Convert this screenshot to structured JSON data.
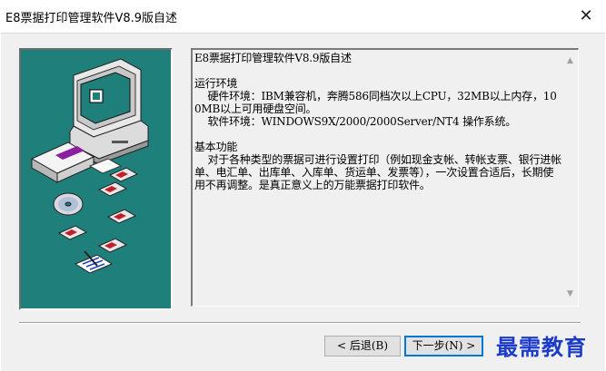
{
  "window": {
    "title": "E8票据打印管理软件V8.9版自述",
    "close_icon": "close-icon"
  },
  "readme": {
    "heading": "E8票据打印管理软件V8.9版自述",
    "env_title": "运行环境",
    "hardware": "    硬件环境：IBM兼容机，奔腾586同档次以上CPU，32MB以上内存，100MB以上可用硬盘空间。",
    "software": "    软件环境：WINDOWS9X/2000/2000Server/NT4 操作系统。",
    "func_title": "基本功能",
    "func_body": "    对于各种类型的票据可进行设置打印（例如现金支帐、转帐支票、银行进帐单、电汇单、出库单、入库单、货运单、发票等），一次设置合适后，长期使用不再调整。是真正意义上的万能票据打印软件。"
  },
  "buttons": {
    "back_label": "< 后退(B)",
    "next_label": "下一步(N) >"
  },
  "watermark": "最需教育",
  "colors": {
    "art_background": "#1f7f7b",
    "watermark": "#1a3cc8"
  },
  "scrollbar": {
    "up_icon": "scroll-up-arrow-icon",
    "down_icon": "scroll-down-arrow-icon"
  }
}
